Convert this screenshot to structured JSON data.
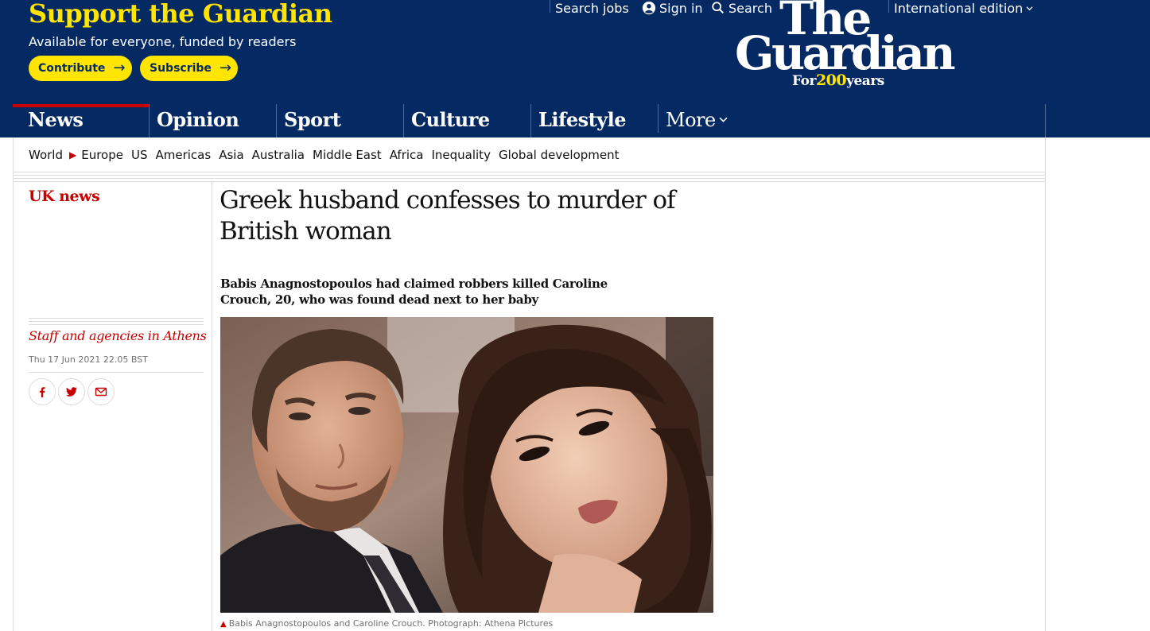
{
  "support": {
    "title": "Support the Guardian",
    "subtitle": "Available for everyone, funded by readers",
    "contribute_label": "Contribute",
    "subscribe_label": "Subscribe"
  },
  "top_links": {
    "search_jobs": "Search jobs",
    "sign_in": "Sign in",
    "search": "Search",
    "edition": "International edition"
  },
  "logo": {
    "the": "The",
    "guardian": "Guardian",
    "tag_for": "For",
    "tag_num": "200",
    "tag_years": "years"
  },
  "nav": {
    "pillars": [
      "News",
      "Opinion",
      "Sport",
      "Culture",
      "Lifestyle"
    ],
    "more_label": "More",
    "active": "News"
  },
  "subnav": {
    "items": [
      "World",
      "Europe",
      "US",
      "Americas",
      "Asia",
      "Australia",
      "Middle East",
      "Africa",
      "Inequality",
      "Global development"
    ],
    "current": "Europe"
  },
  "article": {
    "section": "UK news",
    "headline": "Greek husband confesses to murder of British woman",
    "standfirst": "Babis Anagnostopoulos had claimed robbers killed Caroline Crouch, 20, who was found dead next to her baby",
    "byline": "Staff and agencies in Athens",
    "dateline": "Thu 17 Jun 2021 22.05 BST",
    "caption": "Babis Anagnostopoulos and Caroline Crouch. Photograph: Athena Pictures"
  },
  "share": {
    "icons": [
      "facebook-icon",
      "twitter-icon",
      "email-icon"
    ]
  },
  "colors": {
    "brand_blue": "#052962",
    "support_yellow": "#ffe500",
    "news_red": "#c70000"
  }
}
